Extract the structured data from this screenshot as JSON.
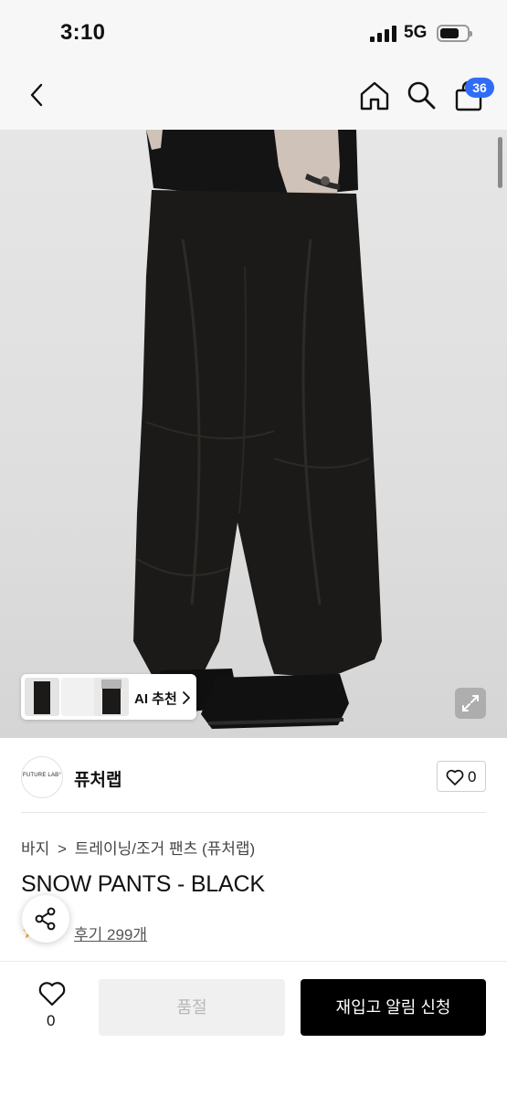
{
  "status_bar": {
    "time": "3:10",
    "network": "5G"
  },
  "header": {
    "cart_count": "36"
  },
  "hero": {
    "ai_recommend_label": "AI 추천"
  },
  "brand": {
    "logo_text": "FUTURE LAB°",
    "name": "퓨처랩",
    "like_count": "0"
  },
  "breadcrumb": {
    "items": [
      "바지",
      "트레이닝/조거 팬츠 (퓨처랩)"
    ],
    "separator": ">"
  },
  "product": {
    "title": "SNOW PANTS - BLACK",
    "rating": "5",
    "review_text": "후기 299개"
  },
  "bottom_bar": {
    "wish_count": "0",
    "soldout_label": "품절",
    "restock_label": "재입고 알림 신청"
  },
  "colors": {
    "accent_badge": "#2f6df6",
    "primary_button": "#000000",
    "rating_star": "#f5a623"
  },
  "icons": [
    "back-icon",
    "home-icon",
    "search-icon",
    "cart-icon",
    "expand-icon",
    "heart-icon",
    "share-icon",
    "star-icon",
    "chevron-right-icon"
  ]
}
